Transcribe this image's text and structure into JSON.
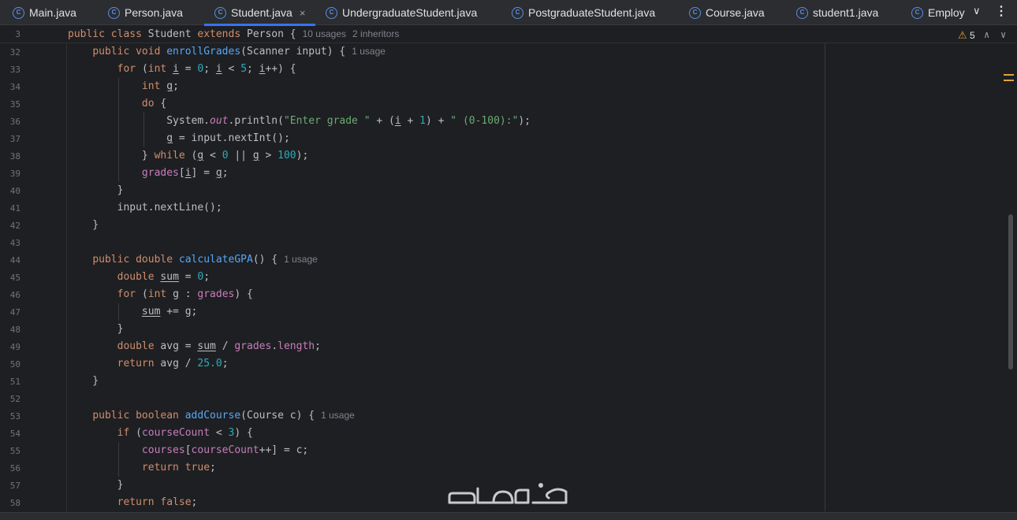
{
  "tabs": [
    {
      "label": "Main.java",
      "icon": "java-class-icon",
      "active": false
    },
    {
      "label": "Person.java",
      "icon": "java-class-icon",
      "active": false
    },
    {
      "label": "Student.java",
      "icon": "java-class-icon",
      "active": true,
      "close": "×"
    },
    {
      "label": "UndergraduateStudent.java",
      "icon": "java-class-icon",
      "active": false
    },
    {
      "label": "PostgraduateStudent.java",
      "icon": "java-class-icon",
      "active": false
    },
    {
      "label": "Course.java",
      "icon": "java-class-icon",
      "active": false
    },
    {
      "label": "student1.java",
      "icon": "java-class-icon",
      "active": false
    },
    {
      "label": "Employ",
      "icon": "java-class-icon",
      "active": false
    }
  ],
  "editor": {
    "sticky_line": {
      "number": "3",
      "hint_usages": "10 usages",
      "hint_inheritors": "2 inheritors"
    },
    "warning_count": "5",
    "line_numbers": [
      "32",
      "33",
      "34",
      "35",
      "36",
      "37",
      "38",
      "39",
      "40",
      "41",
      "42",
      "43",
      "44",
      "45",
      "46",
      "47",
      "48",
      "49",
      "50",
      "51",
      "52",
      "53",
      "54",
      "55",
      "56",
      "57",
      "58"
    ],
    "hints": {
      "l32": "1 usage",
      "l44": "1 usage",
      "l53": "1 usage"
    }
  },
  "colors": {
    "keyword": "#cf8e6d",
    "method": "#56a8f5",
    "field": "#c77dbb",
    "number": "#2aacb8",
    "string": "#6aab73",
    "warning": "#e3a33a",
    "active_tab": "#3574f0"
  },
  "watermark": {
    "name": "khamsat-logo"
  }
}
